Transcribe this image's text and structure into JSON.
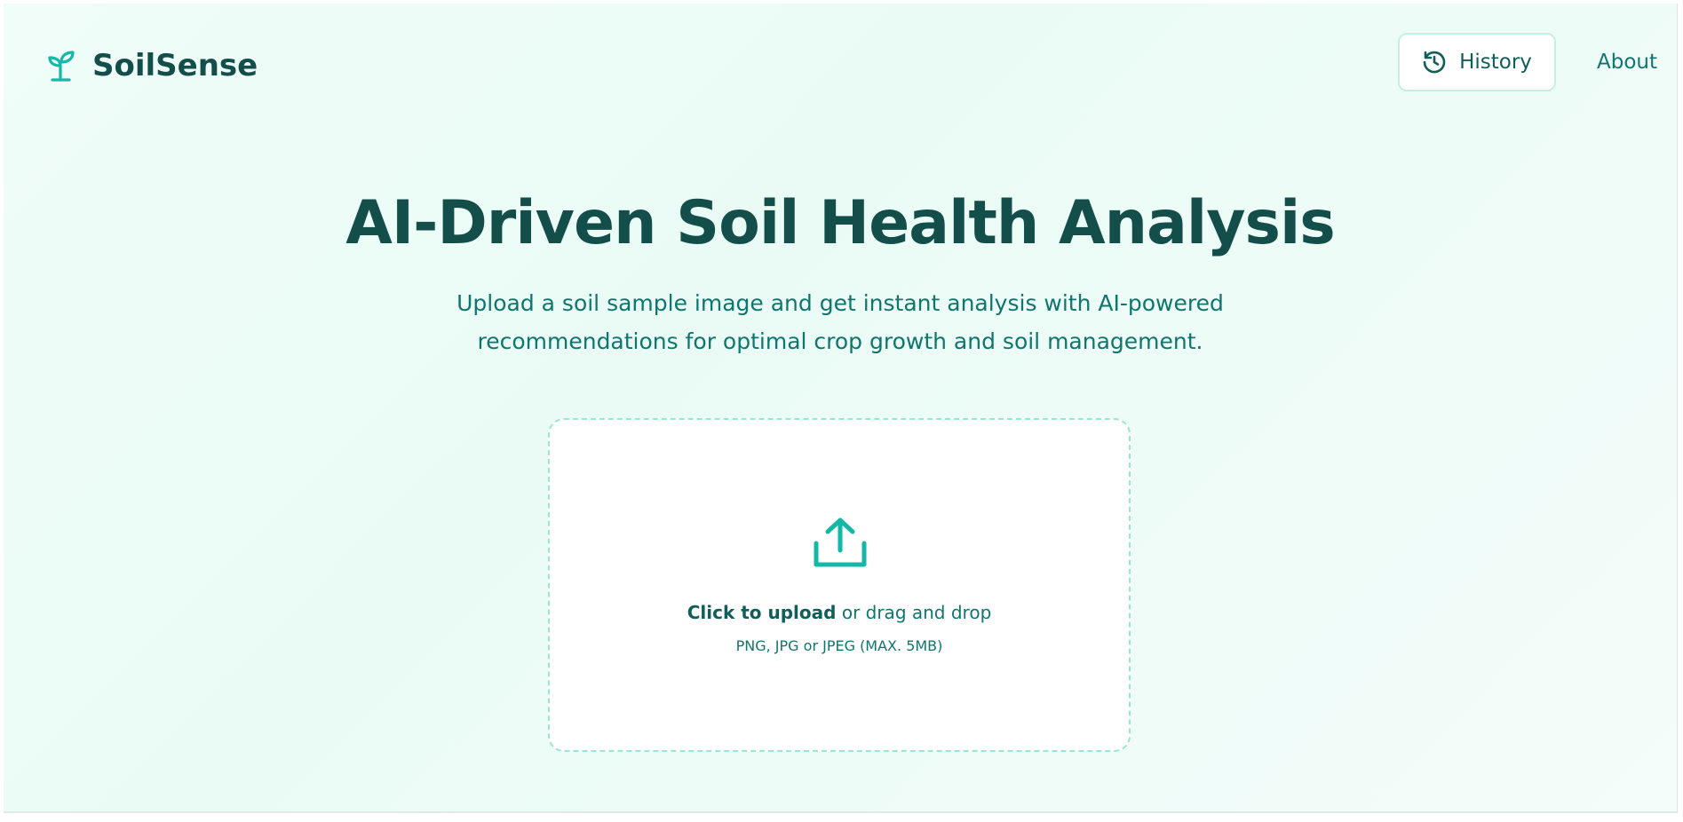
{
  "brand": {
    "icon": "sprout-icon",
    "name": "SoilSense"
  },
  "nav": {
    "history_icon": "history-clock-icon",
    "history_label": "History",
    "about_label": "About"
  },
  "hero": {
    "title": "AI-Driven Soil Health Analysis",
    "subtitle_line1": "Upload a soil sample image and get instant analysis with AI-powered",
    "subtitle_line2": "recommendations for optimal crop growth and soil management."
  },
  "upload": {
    "icon": "upload-icon",
    "click_text": "Click to upload",
    "drag_text": " or drag and drop",
    "hint": "PNG, JPG or JPEG (MAX. 5MB)"
  },
  "colors": {
    "brand_dark": "#134e4a",
    "accent": "#14b8a6",
    "text_teal": "#0f766e",
    "dropzone_border": "#99e6d1"
  }
}
